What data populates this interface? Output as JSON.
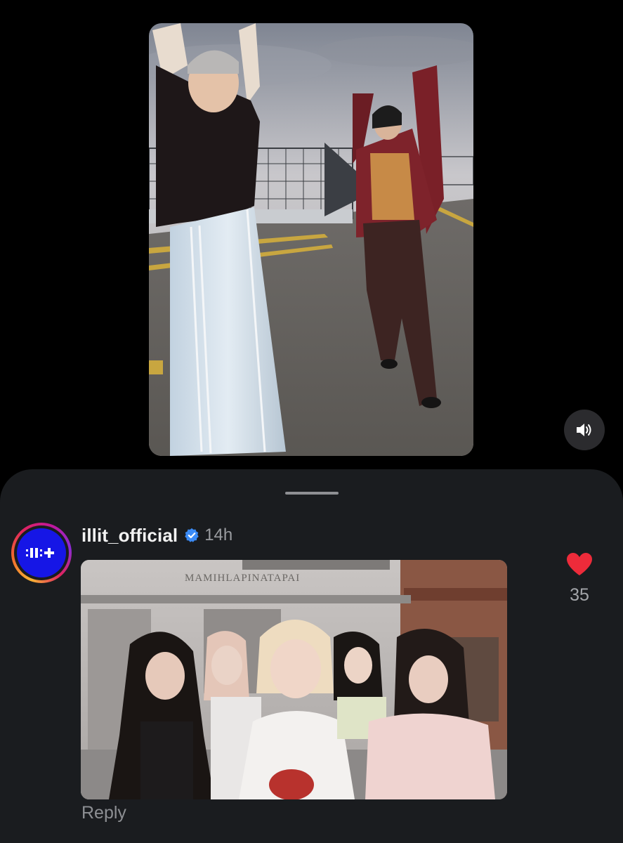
{
  "video": {
    "media_description_icon": "video-thumbnail",
    "mute_icon": "speaker-icon"
  },
  "comment": {
    "username": "illit_official",
    "verified_icon": "verified-badge-icon",
    "timestamp": "14h",
    "avatar_text": ":II:+",
    "avatar_color": "#1616e6",
    "image_sign_text": "MAMIHLAPINATAPAI",
    "reply_label": "Reply"
  },
  "likes": {
    "count": "35",
    "heart_icon": "heart-icon",
    "heart_color": "#ed2b3a",
    "liked": true
  },
  "colors": {
    "sheet_bg": "#1a1c1f",
    "verified_blue": "#3b8bf6"
  }
}
